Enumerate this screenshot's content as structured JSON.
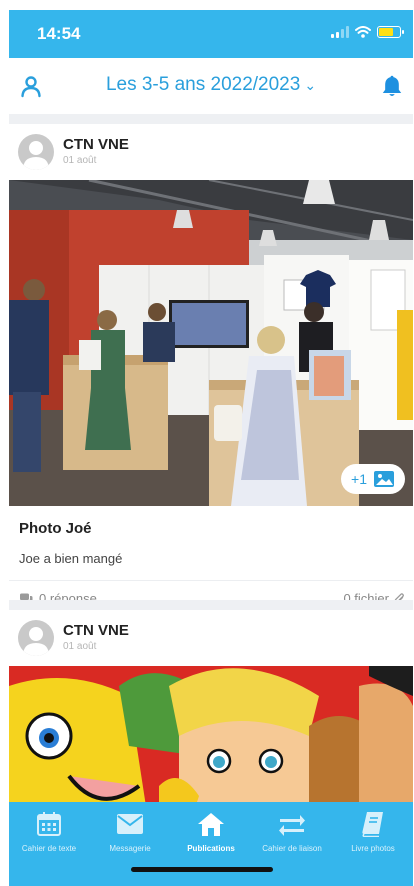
{
  "status_bar": {
    "time": "14:54"
  },
  "header": {
    "title": "Les 3-5 ans 2022/2023",
    "left_icon": "user-icon",
    "right_icon": "bell-icon",
    "dropdown_icon": "chevron-down-icon"
  },
  "posts": [
    {
      "author": "CTN VNE",
      "date": "01 août",
      "photo_badge": "+1",
      "title": "Photo Joé",
      "text": "Joe a bien mangé",
      "replies": "0 réponse",
      "files": "0 fichier"
    },
    {
      "author": "CTN VNE",
      "date": "01 août"
    }
  ],
  "tabs": [
    {
      "label": "Cahier de texte",
      "icon": "calendar-icon",
      "active": false
    },
    {
      "label": "Messagerie",
      "icon": "envelope-icon",
      "active": false
    },
    {
      "label": "Publications",
      "icon": "home-icon",
      "active": true
    },
    {
      "label": "Cahier de liaison",
      "icon": "swap-arrows-icon",
      "active": false
    },
    {
      "label": "Livre photos",
      "icon": "book-icon",
      "active": false
    }
  ],
  "colors": {
    "brand": "#35b6ec",
    "accent_text": "#2a9fdc",
    "bell": "#1e90e0",
    "battery": "#ffe014"
  }
}
